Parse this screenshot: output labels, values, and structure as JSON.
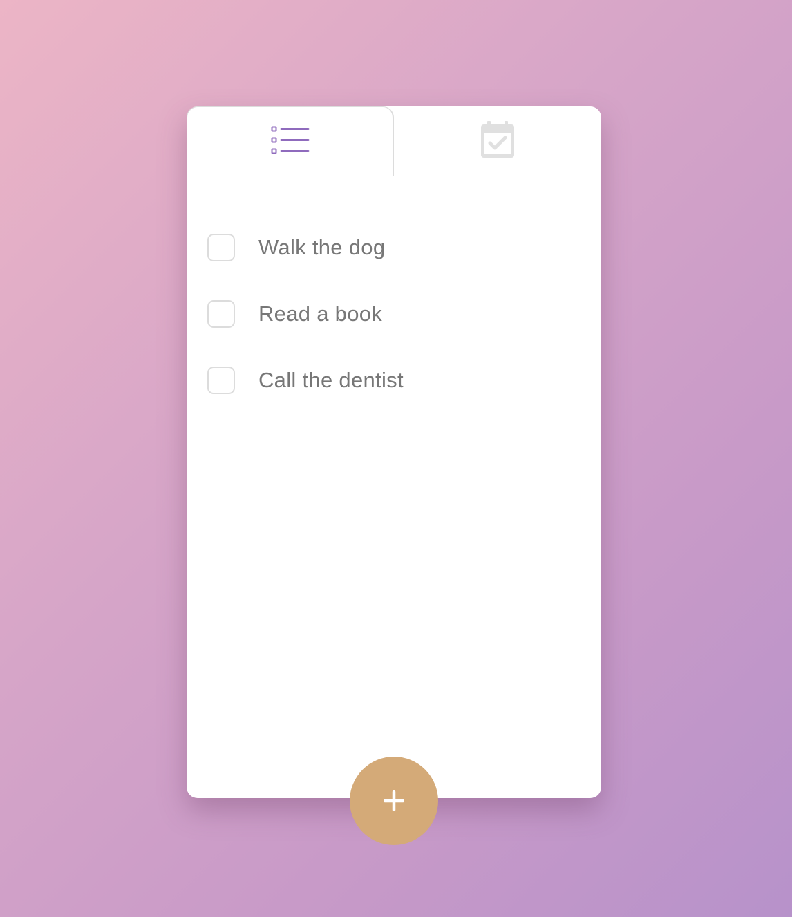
{
  "tabs": [
    {
      "id": "list",
      "icon": "list-icon",
      "active": true,
      "color": "#8f6bbd"
    },
    {
      "id": "calendar",
      "icon": "calendar-check-icon",
      "active": false,
      "color": "#e0e0e0"
    }
  ],
  "tasks": [
    {
      "label": "Walk the dog",
      "checked": false
    },
    {
      "label": "Read a book",
      "checked": false
    },
    {
      "label": "Call the dentist",
      "checked": false
    }
  ],
  "add_button": {
    "icon": "plus-icon",
    "color": "#d4aa78"
  },
  "colors": {
    "background_start": "#ecb5c6",
    "background_end": "#b792ca",
    "card": "#ffffff",
    "text": "#777777",
    "border": "#dcdcdc"
  }
}
